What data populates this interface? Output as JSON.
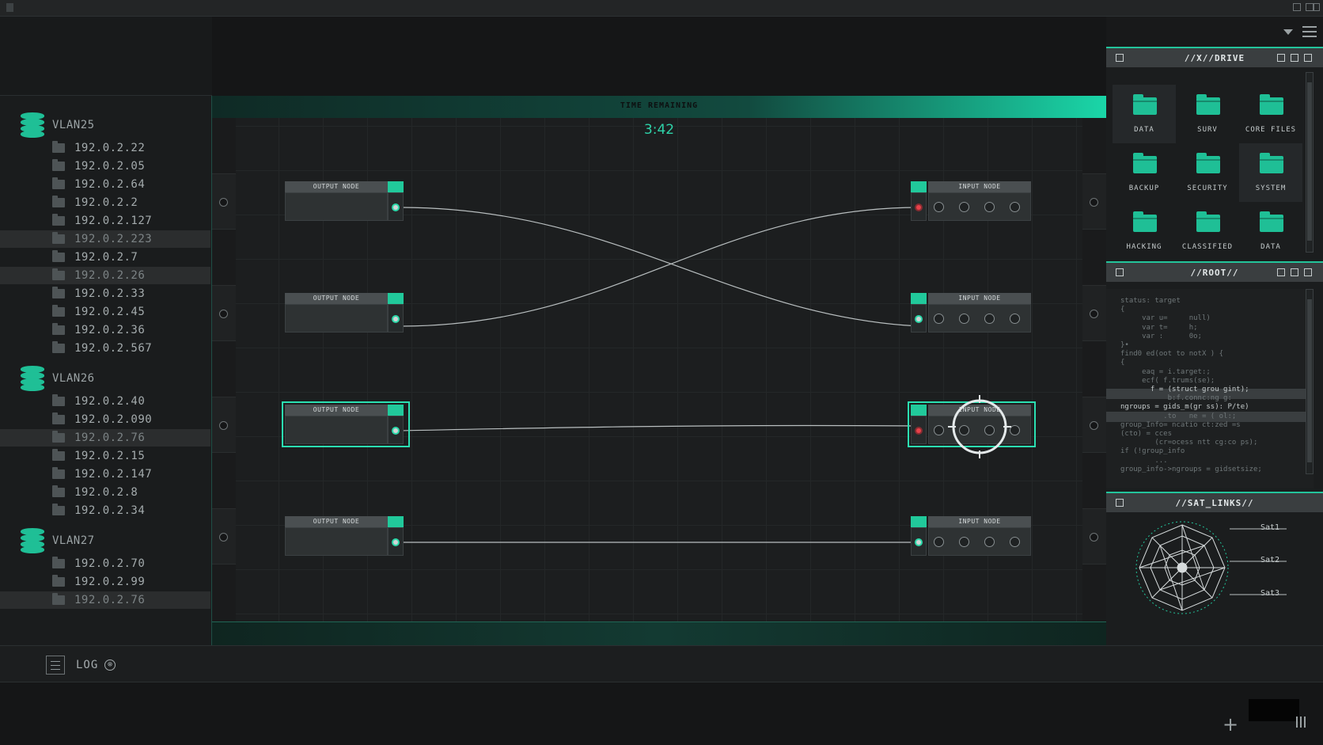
{
  "timer": {
    "label": "TIME REMAINING",
    "value": "3:42"
  },
  "sidebar": {
    "groups": [
      {
        "name": "VLAN25",
        "ips": [
          "192.0.2.22",
          "192.0.2.05",
          "192.0.2.64",
          "192.0.2.2",
          "192.0.2.127",
          "192.0.2.223",
          "192.0.2.7",
          "192.0.2.26",
          "192.0.2.33",
          "192.0.2.45",
          "192.0.2.36",
          "192.0.2.567"
        ]
      },
      {
        "name": "VLAN26",
        "ips": [
          "192.0.2.40",
          "192.0.2.090",
          "192.0.2.76",
          "192.0.2.15",
          "192.0.2.147",
          "192.0.2.8",
          "192.0.2.34"
        ]
      },
      {
        "name": "VLAN27",
        "ips": [
          "192.0.2.70",
          "192.0.2.99",
          "192.0.2.76"
        ]
      }
    ]
  },
  "nodes": {
    "output_label": "OUTPUT NODE",
    "input_label": "INPUT NODE"
  },
  "drive": {
    "title": "//X//DRIVE",
    "folders": [
      "DATA",
      "SURV",
      "CORE FILES",
      "BACKUP",
      "SECURITY",
      "SYSTEM",
      "HACKING",
      "CLASSIFIED",
      "DATA"
    ]
  },
  "root": {
    "title": "//ROOT//",
    "lines": [
      "status: target",
      "{",
      "     var u=     null)",
      "     var t=     h;",
      "     var :      0o;",
      "}•",
      "find0 ed(oot to notX ) {",
      "{",
      "     eaq = i.target:;",
      "     ecf( f.trums(se);",
      "       f = (struct grou gint);",
      "           b:f.connc:ng g:",
      "ngroups = gids_m(gr ss): P/te)",
      "          .to   ne = ( ol:;",
      "group_Info= ncatio ct:zed =s",
      "(cto) = cces",
      "        (cr=ocess ntt cg:co ps);",
      "if (!group_info",
      "        ...",
      "group_info->ngroups = gidsetsize;"
    ]
  },
  "sat": {
    "title": "//SAT_LINKS//",
    "labels": [
      "Sat1",
      "Sat2",
      "Sat3"
    ]
  },
  "log": {
    "label": "LOG",
    "close_glyph": "⊗"
  },
  "footer": {
    "plus_glyph": "+"
  },
  "colors": {
    "accent": "#21c99b",
    "alert": "#e8414a",
    "background": "#151617"
  }
}
